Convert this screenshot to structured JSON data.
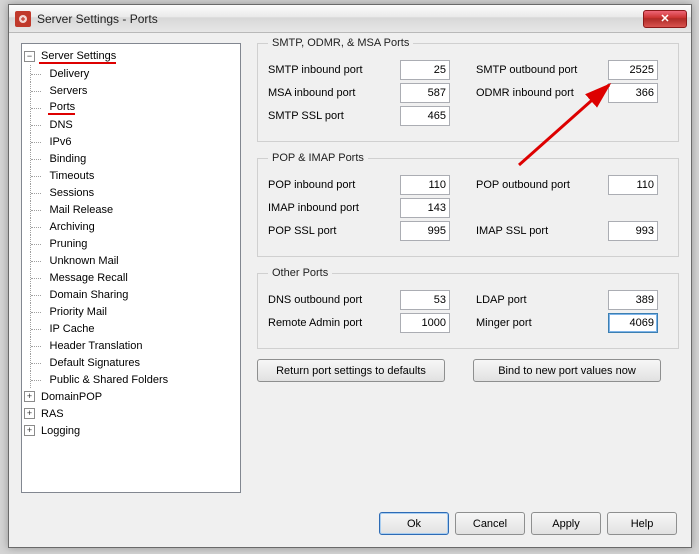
{
  "window": {
    "title": "Server Settings - Ports"
  },
  "tree": {
    "root": "Server Settings",
    "items": [
      "Delivery",
      "Servers",
      "Ports",
      "DNS",
      "IPv6",
      "Binding",
      "Timeouts",
      "Sessions",
      "Mail Release",
      "Archiving",
      "Pruning",
      "Unknown Mail",
      "Message Recall",
      "Domain Sharing",
      "Priority Mail",
      "IP Cache",
      "Header Translation",
      "Default Signatures",
      "Public & Shared Folders"
    ],
    "siblings": [
      "DomainPOP",
      "RAS",
      "Logging"
    ]
  },
  "groups": {
    "smtp": {
      "legend": "SMTP, ODMR, & MSA Ports",
      "smtp_in_label": "SMTP inbound port",
      "smtp_in": "25",
      "smtp_out_label": "SMTP outbound port",
      "smtp_out": "2525",
      "msa_in_label": "MSA inbound port",
      "msa_in": "587",
      "odmr_in_label": "ODMR inbound port",
      "odmr_in": "366",
      "smtp_ssl_label": "SMTP SSL port",
      "smtp_ssl": "465"
    },
    "pop": {
      "legend": "POP & IMAP Ports",
      "pop_in_label": "POP inbound port",
      "pop_in": "110",
      "pop_out_label": "POP outbound port",
      "pop_out": "110",
      "imap_in_label": "IMAP inbound port",
      "imap_in": "143",
      "pop_ssl_label": "POP SSL port",
      "pop_ssl": "995",
      "imap_ssl_label": "IMAP SSL port",
      "imap_ssl": "993"
    },
    "other": {
      "legend": "Other Ports",
      "dns_out_label": "DNS outbound port",
      "dns_out": "53",
      "ldap_label": "LDAP port",
      "ldap": "389",
      "radmin_label": "Remote Admin port",
      "radmin": "1000",
      "minger_label": "Minger port",
      "minger": "4069"
    }
  },
  "buttons": {
    "return_defaults": "Return port settings to defaults",
    "bind_now": "Bind to new port values now",
    "ok": "Ok",
    "cancel": "Cancel",
    "apply": "Apply",
    "help": "Help"
  }
}
